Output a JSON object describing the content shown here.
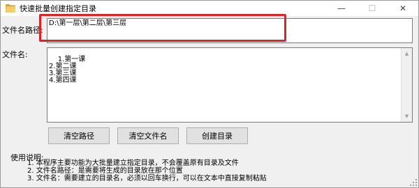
{
  "window": {
    "title": "快速批量创建指定目录",
    "minimize_glyph": "—",
    "maximize_glyph": "☐",
    "close_glyph": "✕"
  },
  "path": {
    "label": "文件名路径:",
    "value": "D:\\第一层\\第二层\\第三层"
  },
  "files": {
    "label": "文件名:",
    "value": "1.第一课\n2.第二课\n3.第三课\n4.第四课"
  },
  "buttons": {
    "clear_path": "清空路径",
    "clear_names": "清空文件名",
    "create_dir": "创建目录"
  },
  "usage": {
    "title": "使用说明:",
    "lines": [
      "1. 本程序主要功能为大批量建立指定目录，不会覆盖原有目录及文件",
      "2. 文件名路径：是需要将生成的目录放在那个位置",
      "3. 文件名：需要建立的目录名，必须以回车换行，可以在文本中直接复制粘贴"
    ]
  },
  "colors": {
    "highlight": "#d9242b",
    "window_bg": "#f0f0f0",
    "button_bg": "#e1e1e1"
  }
}
